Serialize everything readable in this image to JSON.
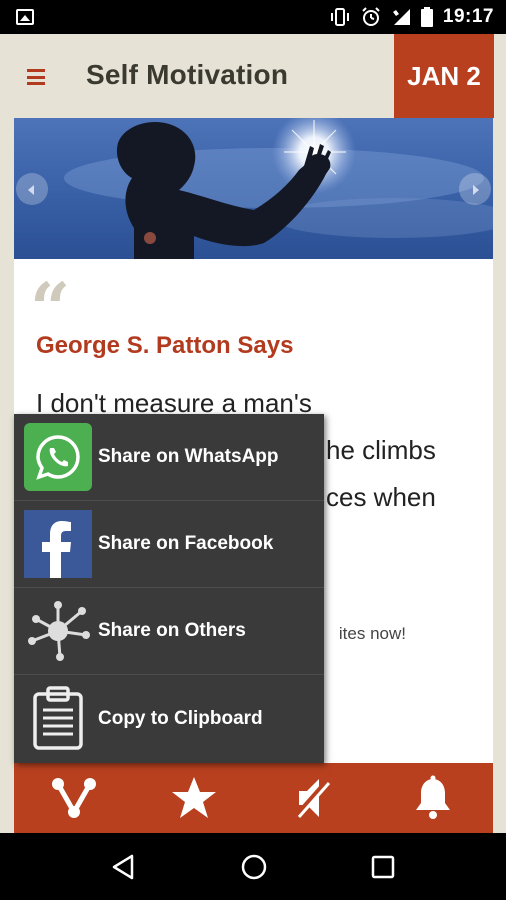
{
  "status": {
    "time": "19:17"
  },
  "header": {
    "title": "Self Motivation",
    "date_badge": "JAN 2"
  },
  "quote": {
    "mark": "“",
    "author": "George S. Patton Says",
    "lines": [
      "I don't measure a man's",
      "he climbs",
      "ces when"
    ],
    "favorites_fragment": "ites now!"
  },
  "share_menu": {
    "items": [
      {
        "label": "Share on WhatsApp",
        "icon": "whatsapp-icon"
      },
      {
        "label": "Share on Facebook",
        "icon": "facebook-icon"
      },
      {
        "label": "Share on Others",
        "icon": "share-network-icon"
      },
      {
        "label": "Copy to Clipboard",
        "icon": "clipboard-icon"
      }
    ]
  },
  "bottom_bar": {
    "icons": [
      "share-icon",
      "star-icon",
      "volume-muted-icon",
      "bell-icon"
    ]
  },
  "colors": {
    "accent": "#b8401f",
    "background": "#e6e3d6",
    "menu": "#3a3a3a"
  }
}
